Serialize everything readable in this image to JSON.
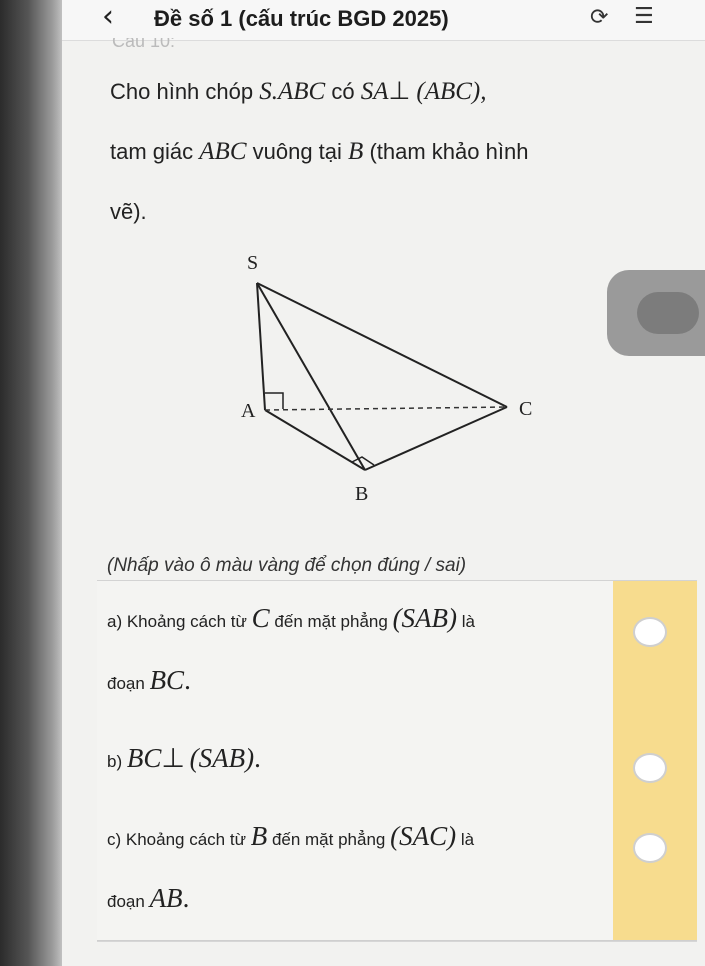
{
  "header": {
    "back_icon": "chevron-left-icon",
    "title": "Đề số 1 (cấu trúc BGD 2025)",
    "refresh_icon": "refresh-icon",
    "list_icon": "list-icon"
  },
  "problem": {
    "heading_partial": "Câu 10:",
    "line1_prefix": "Cho hình chóp",
    "pyramid": "S.ABC",
    "line1_mid": "có",
    "perp_left": "SA",
    "perp_sym": "⊥",
    "perp_right": "(ABC),",
    "line2_prefix": "tam giác",
    "triangle": "ABC",
    "line2_mid": "vuông tại",
    "vertex_B": "B",
    "line2_suffix": "(tham khảo hình",
    "line3": "vẽ)."
  },
  "figure": {
    "label_S": "S",
    "label_A": "A",
    "label_B": "B",
    "label_C": "C"
  },
  "hint": "(Nhấp vào ô màu vàng để chọn đúng / sai)",
  "statements": [
    {
      "prefix": "a) Khoảng cách từ",
      "math1": "C",
      "mid": "đến mặt phẳng",
      "math2": "(SAB)",
      "suffix": "là",
      "line2_prefix": "đoạn",
      "math3": "BC",
      "line2_suffix": "."
    },
    {
      "prefix": "b)",
      "math1": "BC",
      "sym": "⊥",
      "math2": "(SAB)",
      "suffix": "."
    },
    {
      "prefix": "c) Khoảng cách từ",
      "math1": "B",
      "mid": "đến mặt phẳng",
      "math2": "(SAC)",
      "suffix": "là",
      "line2_prefix": "đoạn",
      "math3": "AB",
      "line2_suffix": "."
    }
  ]
}
